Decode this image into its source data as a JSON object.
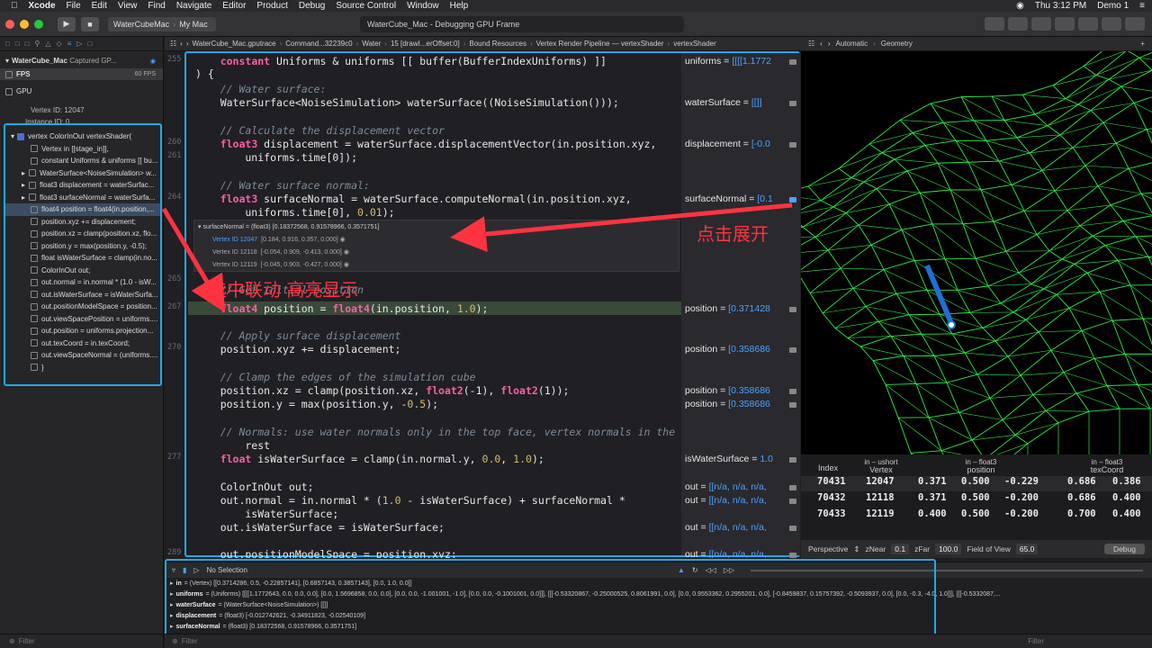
{
  "menubar": {
    "app": "Xcode",
    "items": [
      "File",
      "Edit",
      "View",
      "Find",
      "Navigate",
      "Editor",
      "Product",
      "Debug",
      "Source Control",
      "Window",
      "Help"
    ],
    "clock": "Thu 3:12 PM",
    "user": "Demo 1"
  },
  "toolbar": {
    "scheme": "WaterCubeMac",
    "destination": "My Mac",
    "status": "WaterCube_Mac - Debugging GPU Frame"
  },
  "navigator": {
    "root": "WaterCube_Mac",
    "root_sub": "Captured GP...",
    "fps_label": "FPS",
    "fps_value": "60 FPS",
    "gpu_label": "GPU",
    "vertex_id": "Vertex ID:  12047",
    "instance_id": "Instance ID:  0",
    "function": "vertex ColorInOut vertexShader(",
    "items": [
      "Vertex in [[stage_in]],",
      "constant Uniforms & uniforms [[ bu...",
      "WaterSurface<NoiseSimulation> w...",
      "float3 displacement = waterSurfac...",
      "float3 surfaceNormal = waterSurfa...",
      "float4 position = float4(in.position,...",
      "position.xyz += displacement;",
      "position.xz = clamp(position.xz, flo...",
      "position.y = max(position.y, -0.5);",
      "float isWaterSurface = clamp(in.no...",
      "ColorInOut out;",
      "out.normal = in.normal * (1.0 - isW...",
      "out.isWaterSurface = isWaterSurfa...",
      "out.positionModelSpace = position...",
      "out.viewSpacePosition = uniforms....",
      "out.position = uniforms.projection...",
      "out.texCoord = in.texCoord;",
      "out.viewSpaceNormal = (uniforms....",
      "}"
    ],
    "filter_placeholder": "Filter"
  },
  "jumpbar": [
    "WaterCube_Mac.gputrace",
    "Command...32239c0",
    "Water",
    "15 [drawI...erOffset:0]",
    "Bound Resources",
    "Vertex Render Pipeline — vertexShader",
    "vertexShader"
  ],
  "code": {
    "line_numbers": [
      "255",
      "",
      "",
      "",
      "",
      "",
      "260",
      "261",
      "",
      "",
      "",
      "",
      "264",
      "",
      "",
      "",
      "",
      "265",
      "",
      "267",
      "",
      "",
      "270",
      "",
      "",
      "",
      "",
      "",
      "",
      "277",
      "",
      "",
      "",
      "",
      "281",
      "",
      "",
      "",
      "289"
    ],
    "lines": [
      {
        "t": "    constant Uniforms & uniforms [[ buffer(BufferIndexUniforms) ]]"
      },
      {
        "t": ") {"
      },
      {
        "t": "    // Water surface:"
      },
      {
        "t": "    WaterSurface<NoiseSimulation> waterSurface((NoiseSimulation()));"
      },
      {
        "t": "    // Calculate the displacement vector"
      },
      {
        "t": "    float3 displacement = waterSurface.displacementVector(in.position.xyz,"
      },
      {
        "t": "        uniforms.time[0]);"
      },
      {
        "t": "    // Water surface normal:"
      },
      {
        "t": "    float3 surfaceNormal = waterSurface.computeNormal(in.position.xyz,"
      },
      {
        "t": "        uniforms.time[0], 0.01);"
      },
      {
        "t": "    // Get initial position"
      },
      {
        "t": "    float4 position = float4(in.position, 1.0);"
      },
      {
        "t": "    // Apply surface displacement"
      },
      {
        "t": "    position.xyz += displacement;"
      },
      {
        "t": "    // Clamp the edges of the simulation cube"
      },
      {
        "t": "    position.xz = clamp(position.xz, float2(-1), float2(1));"
      },
      {
        "t": "    position.y = max(position.y, -0.5);"
      },
      {
        "t": "    // Normals: use water normals only in the top face, vertex normals in the"
      },
      {
        "t": "        rest"
      },
      {
        "t": "    float isWaterSurface = clamp(in.normal.y, 0.0, 1.0);"
      },
      {
        "t": "    ColorInOut out;"
      },
      {
        "t": "    out.normal = in.normal * (1.0 - isWaterSurface) + surfaceNormal *"
      },
      {
        "t": "        isWaterSurface;"
      },
      {
        "t": "    out.isWaterSurface = isWaterSurface;"
      },
      {
        "t": "    out.positionModelSpace = position.xyz;"
      }
    ],
    "values": [
      {
        "k": "uniforms = ",
        "v": "[[[[1.1772"
      },
      {
        "k": "waterSurface = ",
        "v": "[[]]"
      },
      {
        "k": "displacement = ",
        "v": "[-0.0"
      },
      {
        "k": "surfaceNormal = ",
        "v": "[0.1"
      },
      {
        "k": "position = ",
        "v": "[0.371428"
      },
      {
        "k": "position = ",
        "v": "[0.358686"
      },
      {
        "k": "position = ",
        "v": "[0.358686"
      },
      {
        "k": "position = ",
        "v": "[0.358686"
      },
      {
        "k": "isWaterSurface = ",
        "v": "1.0"
      },
      {
        "k": "out = ",
        "v": "[[n/a, n/a, n/a,"
      },
      {
        "k": "out = ",
        "v": "[[n/a, n/a, n/a,"
      },
      {
        "k": "out = ",
        "v": "[[n/a, n/a, n/a,"
      },
      {
        "k": "out = ",
        "v": "[[n/a, n/a, n/a,"
      }
    ],
    "popup": {
      "header": "surfaceNormal = (float3) [0.18372568, 0.91578966, 0.3571751]",
      "rows": [
        {
          "id": "Vertex ID 12047",
          "v": "[0.184, 0.916, 0.357, 0.000]"
        },
        {
          "id": "Vertex ID 12118",
          "v": "[-0.054, 0.909, -0.413, 0.000]"
        },
        {
          "id": "Vertex ID 12119",
          "v": "[-0.045, 0.903, -0.427, 0.000]"
        }
      ]
    }
  },
  "geometry": {
    "jump": [
      "Automatic",
      "Geometry"
    ],
    "table": {
      "headers": [
        {
          "top": "",
          "name": "Index"
        },
        {
          "top": "in – ushort",
          "name": "Vertex"
        },
        {
          "top": "in – float3",
          "name": "position"
        },
        {
          "top": "in – float3",
          "name": "texCoord"
        }
      ],
      "rows": [
        [
          "70431",
          "12047",
          "0.371",
          "0.500",
          "-0.229",
          "0.686",
          "0.386"
        ],
        [
          "70432",
          "12118",
          "0.371",
          "0.500",
          "-0.200",
          "0.686",
          "0.400"
        ],
        [
          "70433",
          "12119",
          "0.400",
          "0.500",
          "-0.200",
          "0.700",
          "0.400"
        ]
      ]
    },
    "bar": {
      "projection": "Perspective",
      "znear_label": "zNear",
      "znear": "0.1",
      "zfar_label": "zFar",
      "zfar": "100.0",
      "fov_label": "Field of View",
      "fov": "65.0",
      "debug": "Debug"
    }
  },
  "debug_area": {
    "selection": "No Selection",
    "variables": [
      {
        "name": "in",
        "value": "= (Vertex) [[0.3714286, 0.5, -0.22857141], [0.6857143, 0.3857143], [0.0, 1.0, 0.0]]"
      },
      {
        "name": "uniforms",
        "value": "= (Uniforms) [[[[1.1772643, 0.0, 0.0, 0.0], [0.0, 1.5696858, 0.0, 0.0], [0.0, 0.0, -1.001001, -1.0], [0.0, 0.0, -0.1001001, 0.0]]], [[[-0.53320867, -0.25000525, 0.8061991, 0.0], [0.0, 0.9553362, 0.2955201, 0.0], [-0.8459837, 0.15757392, -0.5093937, 0.0], [0.0, -0.3, -4.0, 1.0]]], [[[-0.5332087,..."
      },
      {
        "name": "waterSurface",
        "value": "= (WaterSurface<NoiseSimulation>) [[]]"
      },
      {
        "name": "displacement",
        "value": "= (float3) [-0.012742621, -0.34911823, -0.02540109]"
      },
      {
        "name": "surfaceNormal",
        "value": "= (float3) [0.18372568, 0.91578966, 0.3571751]"
      }
    ],
    "filter_left": "Filter",
    "filter_right": "Filter"
  },
  "annotations": {
    "expand": "点击展开",
    "link": "选中联动 高亮显示"
  },
  "colors": {
    "accent": "#1fa9e8",
    "arrow": "#ff3340",
    "mesh": "#2ee84a"
  }
}
